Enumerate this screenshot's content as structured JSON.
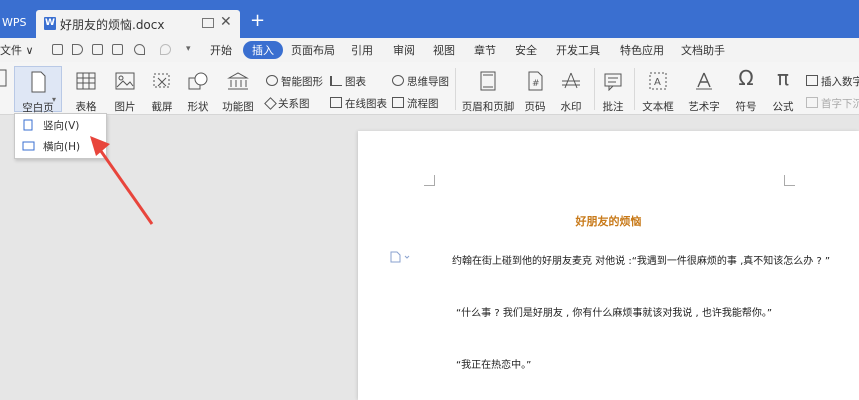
{
  "titlebar": {
    "app_tab": "WPS",
    "doc_tab": "好朋友的烦恼.docx",
    "doc_icon_letter": "W",
    "close_glyph": "✕",
    "add_glyph": "+"
  },
  "menubar": {
    "file_label": "文件 ∨",
    "items": [
      "开始",
      "插入",
      "页面布局",
      "引用",
      "审阅",
      "视图",
      "章节",
      "安全",
      "开发工具",
      "特色应用",
      "文档助手"
    ],
    "active_index": 1
  },
  "ribbon": {
    "blank_page": "空白页",
    "table": "表格",
    "picture": "图片",
    "screenshot": "截屏",
    "shape": "形状",
    "function_chart": "功能图",
    "smart_shape": "智能图形",
    "chart": "图表",
    "mind_map": "思维导图",
    "relation_chart": "关系图",
    "online_chart": "在线图表",
    "flowchart": "流程图",
    "header_footer": "页眉和页脚",
    "page_number": "页码",
    "watermark": "水印",
    "comment": "批注",
    "text_box": "文本框",
    "art_text": "艺术字",
    "symbol": "符号",
    "formula": "公式",
    "insert_number": "插入数字",
    "first_letter": "首字下沉",
    "dropdown_caret": "▾"
  },
  "dropdown": {
    "portrait": "竖向(V)",
    "landscape": "横向(H)"
  },
  "document": {
    "title": "好朋友的烦恼",
    "paragraphs": [
      "约翰在街上碰到他的好朋友麦克 对他说 :“我遇到一件很麻烦的事 ,真不知该怎么办 ? ”",
      "“什么事 ? 我们是好朋友 , 你有什么麻烦事就该对我说 , 也许我能帮你。”",
      "“我正在热恋中。”"
    ]
  },
  "colors": {
    "accent": "#3a6fd0",
    "title_color": "#c87a1a",
    "arrow": "#e8453c"
  }
}
